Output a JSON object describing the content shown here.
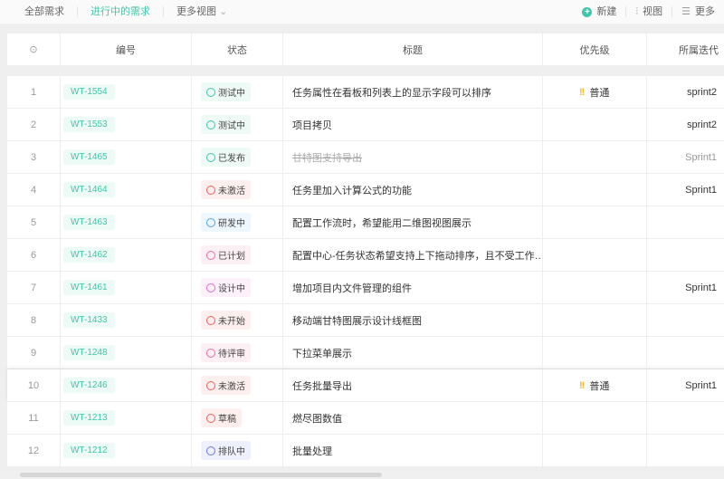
{
  "tabs": [
    "全部需求",
    "进行中的需求",
    "更多视图"
  ],
  "tools": {
    "new": "新建",
    "view": "视图",
    "more": "更多"
  },
  "columns": [
    "编号",
    "状态",
    "标题",
    "优先级",
    "所属迭代"
  ],
  "rows": [
    {
      "n": "1",
      "id": "WT-1554",
      "status": "测试中",
      "color": "#3cc8a8",
      "bg": "#eefaf6",
      "title": "任务属性在看板和列表上的显示字段可以排序",
      "priority": "普通",
      "sprint": "sprint2"
    },
    {
      "n": "2",
      "id": "WT-1553",
      "status": "测试中",
      "color": "#3cc8a8",
      "bg": "#eefaf6",
      "title": "项目拷贝",
      "priority": "",
      "sprint": "sprint2"
    },
    {
      "n": "3",
      "id": "WT-1465",
      "status": "已发布",
      "color": "#3cc8a8",
      "bg": "#eefaf6",
      "title": "甘特图支持导出",
      "priority": "",
      "sprint": "Sprint1",
      "done": true
    },
    {
      "n": "4",
      "id": "WT-1464",
      "status": "未激活",
      "color": "#f0625a",
      "bg": "#fdefee",
      "title": "任务里加入计算公式的功能",
      "priority": "",
      "sprint": "Sprint1"
    },
    {
      "n": "5",
      "id": "WT-1463",
      "status": "研发中",
      "color": "#4aa8f0",
      "bg": "#eef6fe",
      "title": "配置工作流时，希望能用二维图视图展示",
      "priority": "",
      "sprint": ""
    },
    {
      "n": "6",
      "id": "WT-1462",
      "status": "已计划",
      "color": "#ee6aa0",
      "bg": "#fdf0f5",
      "title": "配置中心-任务状态希望支持上下拖动排序，且不受工作…",
      "priority": "",
      "sprint": ""
    },
    {
      "n": "7",
      "id": "WT-1461",
      "status": "设计中",
      "color": "#de6ad8",
      "bg": "#fcf1fb",
      "title": "增加项目内文件管理的组件",
      "priority": "",
      "sprint": "Sprint1"
    },
    {
      "n": "8",
      "id": "WT-1433",
      "status": "未开始",
      "color": "#f0625a",
      "bg": "#fdefee",
      "title": "移动端甘特图展示设计线框图",
      "priority": "",
      "sprint": ""
    },
    {
      "n": "9",
      "id": "WT-1248",
      "status": "待评审",
      "color": "#ee6aa0",
      "bg": "#fdf0f5",
      "title": "下拉菜单展示",
      "priority": "",
      "sprint": ""
    },
    {
      "n": "10",
      "id": "WT-1246",
      "status": "未激活",
      "color": "#f0625a",
      "bg": "#fdefee",
      "title": "任务批量导出",
      "priority": "普通",
      "sprint": "Sprint1"
    },
    {
      "n": "11",
      "id": "WT-1213",
      "status": "草稿",
      "color": "#f0625a",
      "bg": "#fdefee",
      "title": "燃尽图数值",
      "priority": "",
      "sprint": ""
    },
    {
      "n": "12",
      "id": "WT-1212",
      "status": "排队中",
      "color": "#6a78e8",
      "bg": "#eff0fd",
      "title": "批量处理",
      "priority": "",
      "sprint": ""
    }
  ]
}
